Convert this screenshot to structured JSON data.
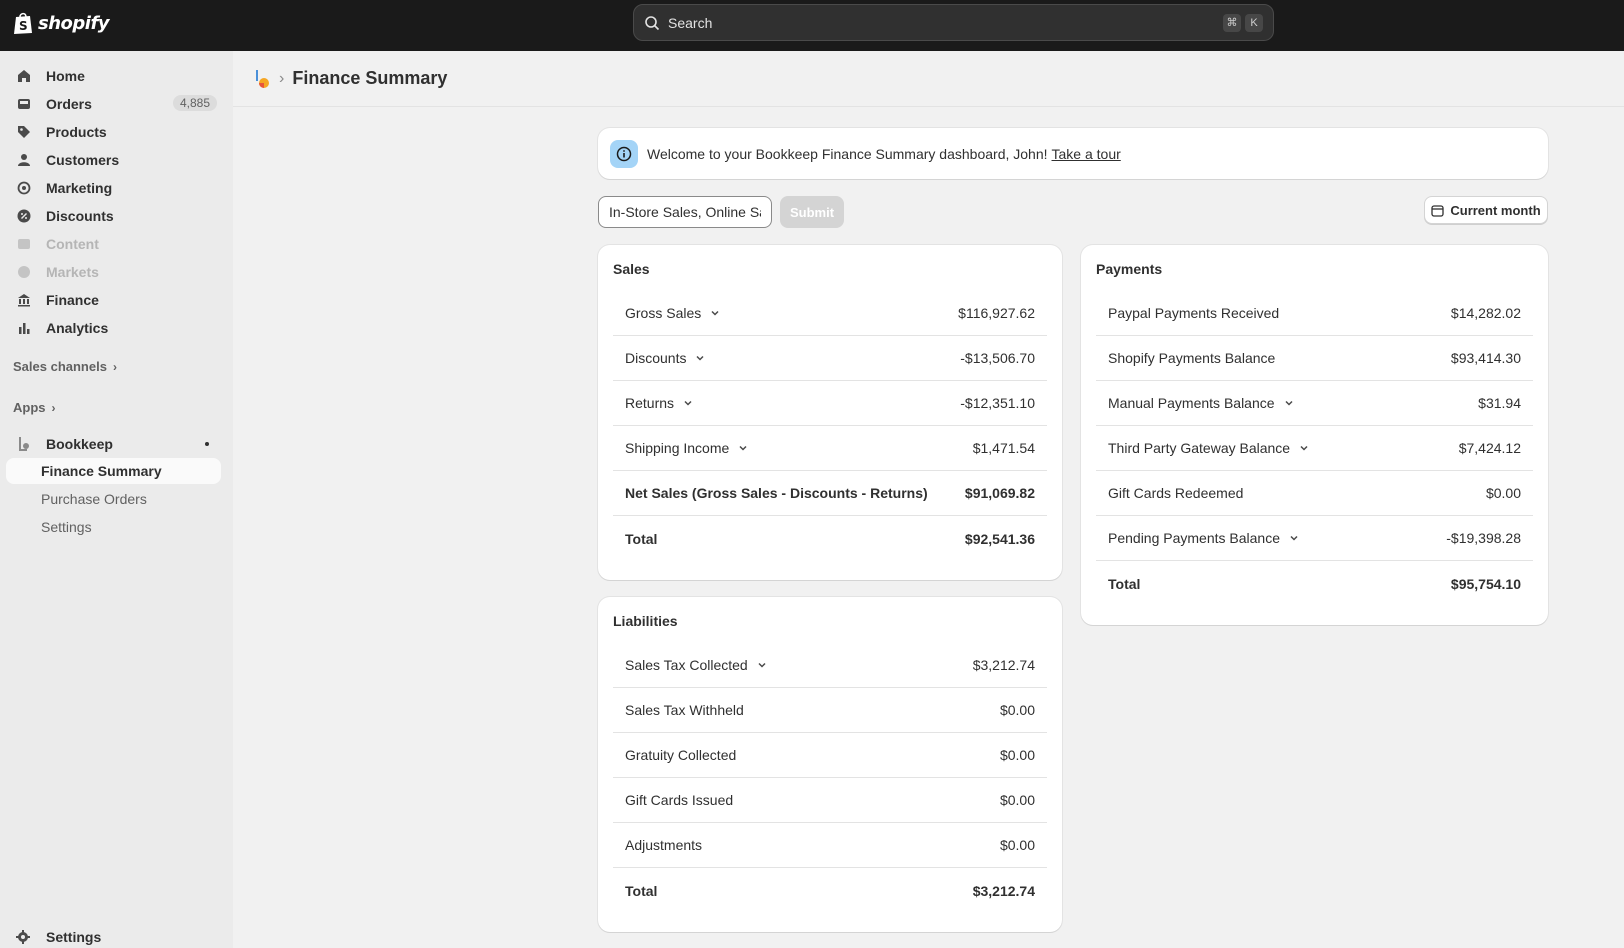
{
  "brand": {
    "name": "shopify"
  },
  "search": {
    "placeholder": "Search",
    "shortcut_keys": [
      "⌘",
      "K"
    ]
  },
  "sidebar": {
    "items": [
      {
        "label": "Home",
        "icon": "home-icon"
      },
      {
        "label": "Orders",
        "icon": "orders-icon",
        "badge": "4,885"
      },
      {
        "label": "Products",
        "icon": "tag-icon"
      },
      {
        "label": "Customers",
        "icon": "person-icon"
      },
      {
        "label": "Marketing",
        "icon": "target-icon"
      },
      {
        "label": "Discounts",
        "icon": "discount-icon"
      },
      {
        "label": "Content",
        "icon": "content-icon",
        "disabled": true
      },
      {
        "label": "Markets",
        "icon": "globe-icon",
        "disabled": true
      },
      {
        "label": "Finance",
        "icon": "bank-icon"
      },
      {
        "label": "Analytics",
        "icon": "bar-chart-icon"
      }
    ],
    "sales_channels_label": "Sales channels",
    "apps_label": "Apps",
    "app": {
      "name": "Bookkeep",
      "sub_items": [
        "Finance Summary",
        "Purchase Orders",
        "Settings"
      ],
      "active_sub_item": "Finance Summary"
    },
    "settings_label": "Settings"
  },
  "header": {
    "title": "Finance Summary"
  },
  "banner": {
    "text": "Welcome to your Bookkeep Finance Summary dashboard, John!",
    "link": "Take a tour"
  },
  "filter": {
    "value": "In-Store Sales, Online Sales",
    "submit_label": "Submit",
    "period_label": "Current month"
  },
  "sales": {
    "title": "Sales",
    "rows": [
      {
        "label": "Gross Sales",
        "value": "$116,927.62",
        "expandable": true
      },
      {
        "label": "Discounts",
        "value": "-$13,506.70",
        "expandable": true
      },
      {
        "label": "Returns",
        "value": "-$12,351.10",
        "expandable": true
      },
      {
        "label": "Shipping Income",
        "value": "$1,471.54",
        "expandable": true
      },
      {
        "label": "Net Sales (Gross Sales - Discounts - Returns)",
        "value": "$91,069.82",
        "bold": true
      },
      {
        "label": "Total",
        "value": "$92,541.36",
        "bold": true
      }
    ]
  },
  "liabilities": {
    "title": "Liabilities",
    "rows": [
      {
        "label": "Sales Tax Collected",
        "value": "$3,212.74",
        "expandable": true
      },
      {
        "label": "Sales Tax Withheld",
        "value": "$0.00"
      },
      {
        "label": "Gratuity Collected",
        "value": "$0.00"
      },
      {
        "label": "Gift Cards Issued",
        "value": "$0.00"
      },
      {
        "label": "Adjustments",
        "value": "$0.00"
      },
      {
        "label": "Total",
        "value": "$3,212.74",
        "bold": true
      }
    ]
  },
  "payments": {
    "title": "Payments",
    "rows": [
      {
        "label": "Paypal Payments Received",
        "value": "$14,282.02"
      },
      {
        "label": "Shopify Payments Balance",
        "value": "$93,414.30"
      },
      {
        "label": "Manual Payments Balance",
        "value": "$31.94",
        "expandable": true
      },
      {
        "label": "Third Party Gateway Balance",
        "value": "$7,424.12",
        "expandable": true
      },
      {
        "label": "Gift Cards Redeemed",
        "value": "$0.00"
      },
      {
        "label": "Pending Payments Balance",
        "value": "-$19,398.28",
        "expandable": true
      },
      {
        "label": "Total",
        "value": "$95,754.10",
        "bold": true
      }
    ]
  },
  "colors": {
    "topbar": "#1a1a1a",
    "sidebar": "#ebebeb",
    "page": "#f1f1f1",
    "info_accent": "#a4d4f7"
  }
}
